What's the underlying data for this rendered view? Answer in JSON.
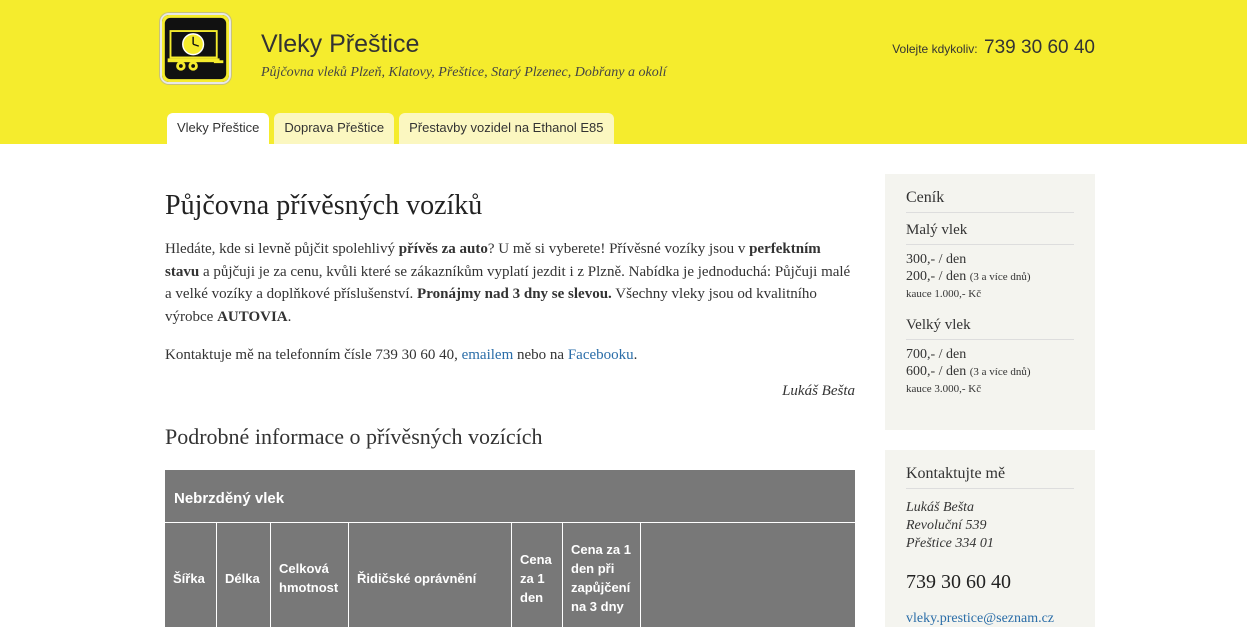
{
  "header": {
    "title": "Vleky Přeštice",
    "subtitle": "Půjčovna vleků Plzeň, Klatovy, Přeštice, Starý Plzenec, Dobřany a okolí",
    "phone_label": "Volejte kdykoliv:",
    "phone_number": "739 30 60 40",
    "bg_color": "#f5ec2d",
    "logo_icon": "trailer-clock-logo"
  },
  "tabs": [
    {
      "label": "Vleky Přeštice",
      "active": true
    },
    {
      "label": "Doprava Přeštice",
      "active": false
    },
    {
      "label": "Přestavby vozidel na Ethanol E85",
      "active": false
    }
  ],
  "main": {
    "title": "Půjčovna přívěsných vozíků",
    "intro": {
      "t1": "Hledáte, kde si levně půjčit spolehlivý ",
      "b1": "přívěs za auto",
      "t2": "? U mě si vyberete! Přívěsné vozíky jsou v ",
      "b2": "perfektním stavu",
      "t3": " a půjčuji je za cenu, kvůli které se zákazníkům vyplatí jezdit i z Plzně. Nabídka je jednoduchá: Půjčuji malé a velké vozíky a doplňkové příslušenství. ",
      "b3": "Pronájmy nad 3 dny se slevou.",
      "t4": " Všechny vleky jsou od kvalitního výrobce ",
      "b4": "AUTOVIA",
      "t5": "."
    },
    "contact": {
      "t1": "Kontaktuje mě na telefonním čísle 739 30 60 40, ",
      "email_link": "emailem",
      "t2": " nebo na ",
      "fb_link": "Facebooku",
      "t3": "."
    },
    "signature": "Lukáš Bešta",
    "section_title": "Podrobné informace o přívěsných vozících",
    "table": {
      "caption": "Nebrzděný vlek",
      "columns": [
        "Šířka",
        "Délka",
        "Celková hmotnost",
        "Řidičské oprávnění",
        "Cena za 1 den",
        "Cena za 1 den při zapůjčení na 3 dny",
        ""
      ]
    }
  },
  "sidebar": {
    "pricing": {
      "title": "Ceník",
      "small": {
        "title": "Malý vlek",
        "p1": "300,- / den",
        "p2": "200,- / den",
        "p2_note": "(3 a více dnů)",
        "deposit": "kauce 1.000,- Kč"
      },
      "large": {
        "title": "Velký vlek",
        "p1": "700,- / den",
        "p2": "600,- / den",
        "p2_note": "(3 a více dnů)",
        "deposit": "kauce 3.000,- Kč"
      }
    },
    "contact": {
      "title": "Kontaktujte mě",
      "name": "Lukáš Bešta",
      "street": "Revoluční 539",
      "city": "Přeštice 334 01",
      "phone": "739 30 60 40",
      "email": "vleky.prestice@seznam.cz"
    }
  }
}
